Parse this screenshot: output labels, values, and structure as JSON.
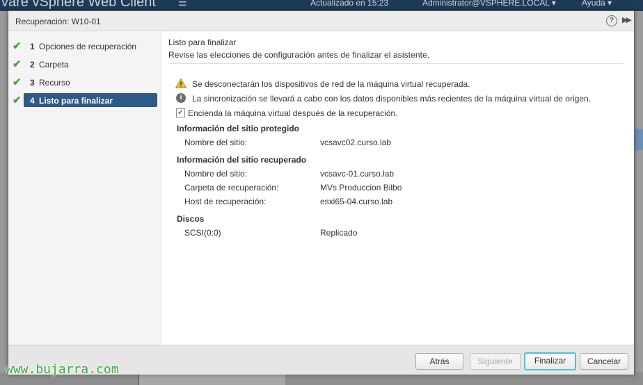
{
  "background": {
    "brand": "vare  vSphere Web Client",
    "updated": "Actualizado en 15:23",
    "user": "Administrator@VSPHERE.LOCAL ▾",
    "help": "Ayuda ▾"
  },
  "dialog": {
    "title": "Recuperación: W10-01",
    "help_icon": "?",
    "expand_icon": "▶▶"
  },
  "steps": [
    {
      "num": "1",
      "label": "Opciones de recuperación",
      "done": true
    },
    {
      "num": "2",
      "label": "Carpeta",
      "done": true
    },
    {
      "num": "3",
      "label": "Recurso",
      "done": true
    },
    {
      "num": "4",
      "label": "Listo para finalizar",
      "done": true,
      "active": true
    }
  ],
  "content": {
    "title": "Listo para finalizar",
    "subtitle": "Revise las elecciones de configuración antes de finalizar el asistente.",
    "warning": "Se desconectarán los dispositivos de red de la máquina virtual recuperada.",
    "info": "La sincronización se llevará a cabo con los datos disponibles más recientes de la máquina virtual de origen.",
    "power_on_label": "Encienda la máquina virtual después de la recuperación.",
    "power_on_checked": true,
    "protected_site": {
      "heading": "Información del sitio protegido",
      "site_name_label": "Nombre del sitio:",
      "site_name_value": "vcsavc02.curso.lab"
    },
    "recovery_site": {
      "heading": "Información del sitio recuperado",
      "site_name_label": "Nombre del sitio:",
      "site_name_value": "vcsavc-01.curso.lab",
      "folder_label": "Carpeta de recuperación:",
      "folder_value": "MVs Produccion Bilbo",
      "host_label": "Host de recuperación:",
      "host_value": "esxi65-04.curso.lab"
    },
    "disks": {
      "heading": "Discos",
      "disk_label": "SCSI(0:0)",
      "disk_value": "Replicado"
    }
  },
  "buttons": {
    "back": "Atrás",
    "next": "Siguiente",
    "finish": "Finalizar",
    "cancel": "Cancelar"
  },
  "watermark": "www.bujarra.com",
  "colors": {
    "active_step": "#2d5a88",
    "check": "#49a33a",
    "focus_border": "#4ec0dd"
  }
}
